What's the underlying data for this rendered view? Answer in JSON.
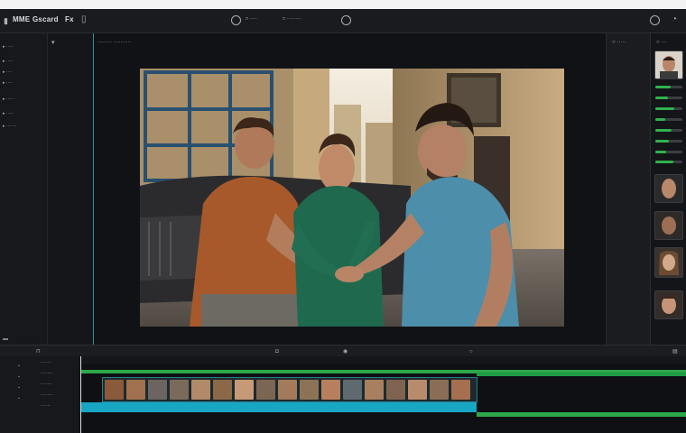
{
  "app": {
    "menu": [
      "MME",
      "Gscard",
      "Fx"
    ]
  },
  "topbar": {
    "center_left_label": "□ ·····",
    "center_right_label": "□ ··········"
  },
  "left_panel": {
    "items": [
      "▸ ·····",
      "▸ ·····",
      "▸ ····",
      "▸ ····",
      "▸ ······",
      "▸ ·····",
      "▸ ·······"
    ]
  },
  "viewer": {
    "title": "········ ··········"
  },
  "inspector": {
    "title": "○ ·····",
    "far_title": "○ ···",
    "slider_levels": [
      0.55,
      0.45,
      0.7,
      0.35,
      0.6,
      0.5,
      0.4,
      0.65
    ]
  },
  "timeline": {
    "track_labels": [
      "········",
      "·········",
      "········",
      "·········",
      "·······"
    ]
  },
  "colors": {
    "accent_cyan": "#17a6c4",
    "track_green": "#2ea84a",
    "panel_dark": "#17181b"
  },
  "icons": [
    "layout-icon",
    "play-icon",
    "record-icon",
    "help-icon",
    "settings-icon"
  ]
}
